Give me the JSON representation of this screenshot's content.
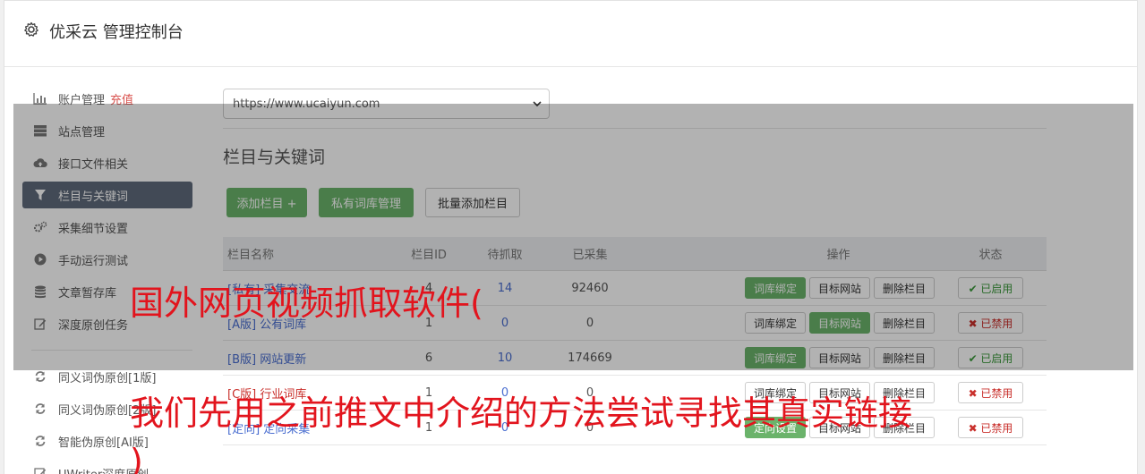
{
  "header": {
    "title": "优采云 管理控制台"
  },
  "sidebar": {
    "items": [
      {
        "label": "账户管理",
        "tag": "充值",
        "icon": "bar-chart-icon"
      },
      {
        "label": "站点管理",
        "icon": "server-icon"
      },
      {
        "label": "接口文件相关",
        "icon": "cloud-upload-icon"
      },
      {
        "label": "栏目与关键词",
        "icon": "filter-icon",
        "active": true
      },
      {
        "label": "采集细节设置",
        "icon": "gears-icon"
      },
      {
        "label": "手动运行测试",
        "icon": "play-circle-icon"
      },
      {
        "label": "文章暂存库",
        "icon": "database-icon"
      },
      {
        "label": "深度原创任务",
        "icon": "edit-icon"
      }
    ],
    "items2": [
      {
        "label": "同义词伪原创[1版]",
        "icon": "refresh-icon"
      },
      {
        "label": "同义词伪原创[2版]",
        "icon": "refresh-icon"
      },
      {
        "label": "智能伪原创[AI版]",
        "icon": "refresh-icon"
      },
      {
        "label": "UWriter深度原创",
        "icon": "edit-icon"
      }
    ]
  },
  "main": {
    "site_select": "https://www.ucaiyun.com",
    "section_title": "栏目与关键词",
    "buttons": {
      "add": "添加栏目 +",
      "private_lib": "私有词库管理",
      "batch_add": "批量添加栏目"
    },
    "table": {
      "headers": {
        "name": "栏目名称",
        "id": "栏目ID",
        "wait": "待抓取",
        "done": "已采集",
        "ops": "操作",
        "status": "状态"
      },
      "rows": [
        {
          "name": "[私有] 采集交流",
          "id": "4",
          "wait": "14",
          "done": "92460",
          "op1": "词库绑定",
          "op1_green": true,
          "op2": "目标网站",
          "op2_green": false,
          "op3": "删除栏目",
          "status": "✔ 已启用",
          "status_on": true,
          "name_red": false
        },
        {
          "name": "[A版] 公有词库",
          "id": "1",
          "wait": "0",
          "done": "0",
          "op1": "词库绑定",
          "op1_green": false,
          "op2": "目标网站",
          "op2_green": true,
          "op3": "删除栏目",
          "status": "✖ 已禁用",
          "status_on": false,
          "name_red": false
        },
        {
          "name": "[B版] 网站更新",
          "id": "6",
          "wait": "10",
          "done": "174669",
          "op1": "词库绑定",
          "op1_green": true,
          "op2": "目标网站",
          "op2_green": false,
          "op3": "删除栏目",
          "status": "✔ 已启用",
          "status_on": true,
          "name_red": false
        },
        {
          "name": "[C版] 行业词库",
          "id": "1",
          "wait": "0",
          "done": "0",
          "op1": "词库绑定",
          "op1_green": false,
          "op2": "目标网站",
          "op2_green": false,
          "op3": "删除栏目",
          "status": "✖ 已禁用",
          "status_on": false,
          "name_red": true
        },
        {
          "name": "[定向] 定向采集",
          "id": "1",
          "wait": "0",
          "done": "0",
          "op1": "定向设置",
          "op1_green": true,
          "op2": "目标网站",
          "op2_green": false,
          "op3": "删除栏目",
          "status": "✖ 已禁用",
          "status_on": false,
          "name_red": false
        }
      ]
    }
  },
  "overlay": {
    "line1": "国外网页视频抓取软件(",
    "line2": "我们先用之前推文中介绍的方法尝试寻找其真实链接",
    "line3": ")"
  },
  "colors": {
    "active_nav": "#5f6b7c",
    "green": "#6bb36b",
    "red_text": "#e2141d",
    "link": "#4a6ed0"
  }
}
